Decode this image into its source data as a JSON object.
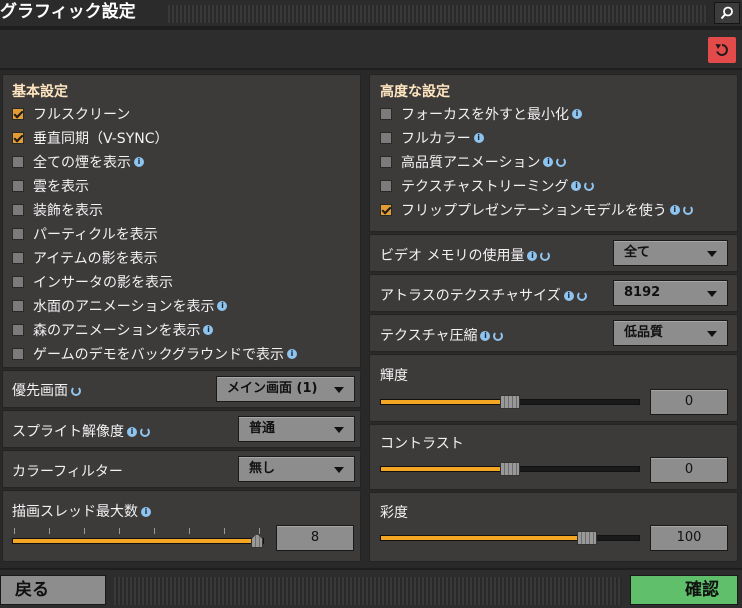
{
  "window": {
    "title": "グラフィック設定"
  },
  "left": {
    "basic_title": "基本設定",
    "checkboxes": [
      {
        "label": "フルスクリーン",
        "checked": true,
        "info": false
      },
      {
        "label": "垂直同期（V-SYNC）",
        "checked": true,
        "info": false
      },
      {
        "label": "全ての煙を表示",
        "checked": false,
        "info": true
      },
      {
        "label": "雲を表示",
        "checked": false,
        "info": false
      },
      {
        "label": "装飾を表示",
        "checked": false,
        "info": false
      },
      {
        "label": "パーティクルを表示",
        "checked": false,
        "info": false
      },
      {
        "label": "アイテムの影を表示",
        "checked": false,
        "info": false
      },
      {
        "label": "インサータの影を表示",
        "checked": false,
        "info": false
      },
      {
        "label": "水面のアニメーションを表示",
        "checked": false,
        "info": true
      },
      {
        "label": "森のアニメーションを表示",
        "checked": false,
        "info": true
      },
      {
        "label": "ゲームのデモをバックグラウンドで表示",
        "checked": false,
        "info": true
      }
    ],
    "priority_screen": {
      "label": "優先画面",
      "value": "メイン画面 (1)"
    },
    "sprite_resolution": {
      "label": "スプライト解像度",
      "value": "普通"
    },
    "color_filter": {
      "label": "カラーフィルター",
      "value": "無し"
    },
    "render_threads": {
      "label": "描画スレッド最大数",
      "value": "8",
      "fraction": 1.0
    }
  },
  "right": {
    "advanced_title": "高度な設定",
    "checkboxes": [
      {
        "label": "フォーカスを外すと最小化",
        "checked": false,
        "info": true,
        "cycle": false
      },
      {
        "label": "フルカラー",
        "checked": false,
        "info": true,
        "cycle": false
      },
      {
        "label": "高品質アニメーション",
        "checked": false,
        "info": true,
        "cycle": true
      },
      {
        "label": "テクスチャストリーミング",
        "checked": false,
        "info": true,
        "cycle": true
      },
      {
        "label": "フリッププレゼンテーションモデルを使う",
        "checked": true,
        "info": true,
        "cycle": true
      }
    ],
    "vram_usage": {
      "label": "ビデオ メモリの使用量",
      "value": "全て"
    },
    "atlas_size": {
      "label": "アトラスのテクスチャサイズ",
      "value": "8192"
    },
    "texture_compression": {
      "label": "テクスチャ圧縮",
      "value": "低品質"
    },
    "brightness": {
      "label": "輝度",
      "value": "0",
      "fraction": 0.5
    },
    "contrast": {
      "label": "コントラスト",
      "value": "0",
      "fraction": 0.5
    },
    "saturation": {
      "label": "彩度",
      "value": "100",
      "fraction": 0.8
    }
  },
  "footer": {
    "back_label": "戻る",
    "confirm_label": "確認"
  },
  "colors": {
    "accent": "#f5a623",
    "reset": "#e34a4a",
    "confirm": "#5fbf6a"
  },
  "icons": {
    "search": "search-icon",
    "reset": "reset-icon",
    "info": "info-icon",
    "cycle": "restart-required-icon"
  }
}
